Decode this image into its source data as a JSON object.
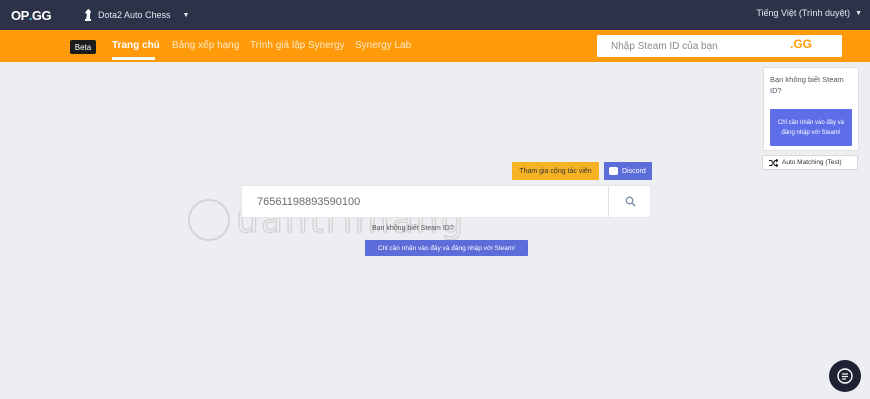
{
  "topbar": {
    "logo_text": "OP",
    "logo_dot": ".",
    "logo_text2": "GG",
    "game_name": "Dota2 Auto Chess",
    "language": "Tiếng Việt (Trình duyệt)"
  },
  "nav": {
    "beta_label": "Beta",
    "items": [
      {
        "label": "Trang chủ",
        "active": true
      },
      {
        "label": "Bảng xếp hạng",
        "active": false
      },
      {
        "label": "Trình giả lập Synergy",
        "active": false
      },
      {
        "label": "Synergy Lab",
        "active": false
      }
    ],
    "search_placeholder": "Nhập Steam ID của bạn",
    "search_button": ".GG"
  },
  "help_card": {
    "text": "Bạn không biết Steam ID?",
    "button": "Chỉ cần nhấn vào đây và đăng nhập với Steam!"
  },
  "auto_matching": {
    "label": "Auto Matching (Test)"
  },
  "main": {
    "collab_button": "Tham gia cộng tác viên",
    "discord_button": "Discord",
    "search_value": "76561198893590100",
    "hint": "Bạn không biết Steam ID?",
    "steam_button": "Chỉ cần nhấn vào đây và đăng nhập với Steam!"
  },
  "watermark": {
    "text": "uantrimang"
  },
  "colors": {
    "topbar": "#2c3248",
    "orange": "#ff9b0b",
    "accent_blue": "#5c6cd8",
    "content_bg": "#eceef1"
  }
}
